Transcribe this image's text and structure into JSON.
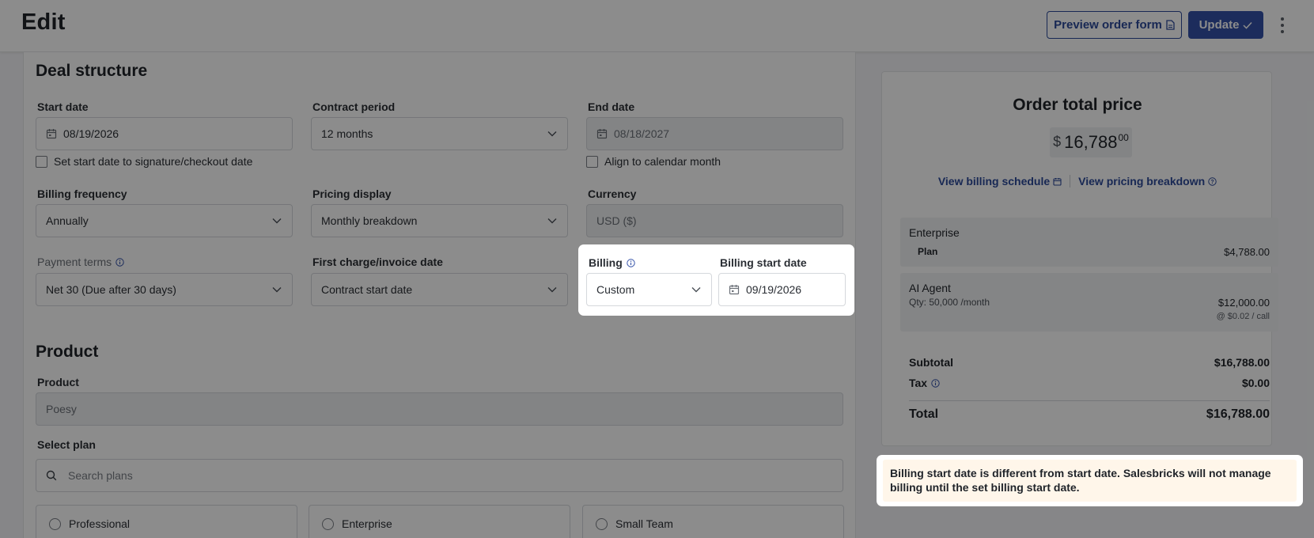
{
  "header": {
    "title": "Edit",
    "preview_label": "Preview order form",
    "update_label": "Update"
  },
  "deal": {
    "title": "Deal structure",
    "start_date": {
      "label": "Start date",
      "value": "08/19/2026"
    },
    "signature_checkbox": "Set start date to signature/checkout date",
    "contract_period": {
      "label": "Contract period",
      "value": "12 months"
    },
    "end_date": {
      "label": "End date",
      "value": "08/18/2027"
    },
    "calendar_checkbox": "Align to calendar month",
    "billing_frequency": {
      "label": "Billing frequency",
      "value": "Annually"
    },
    "pricing_display": {
      "label": "Pricing display",
      "value": "Monthly breakdown"
    },
    "currency": {
      "label": "Currency",
      "value": "USD ($)"
    },
    "payment_terms": {
      "label": "Payment terms",
      "value": "Net 30 (Due after 30 days)"
    },
    "first_charge": {
      "label": "First charge/invoice date",
      "value": "Contract start date"
    },
    "billing": {
      "label": "Billing",
      "value": "Custom"
    },
    "billing_start": {
      "label": "Billing start date",
      "value": "09/19/2026"
    }
  },
  "product": {
    "title": "Product",
    "product_label": "Product",
    "product_value": "Poesy",
    "select_plan_label": "Select plan",
    "search_placeholder": "Search plans",
    "plans": [
      "Professional",
      "Enterprise",
      "Small Team"
    ]
  },
  "summary": {
    "title": "Order total price",
    "currency_symbol": "$",
    "amount": "16,788",
    "cents": "00",
    "billing_schedule_link": "View billing schedule",
    "pricing_breakdown_link": "View pricing breakdown",
    "items": [
      {
        "name": "Enterprise",
        "tag": "Plan",
        "price": "$4,788.00"
      },
      {
        "name": "AI Agent",
        "qty": "Qty: 50,000 /month",
        "price": "$12,000.00",
        "note": "@ $0.02 / call"
      }
    ],
    "subtotal_label": "Subtotal",
    "subtotal": "$16,788.00",
    "tax_label": "Tax",
    "tax": "$0.00",
    "total_label": "Total",
    "total": "$16,788.00"
  },
  "notice": {
    "text": "Billing start date is different from start date. Salesbricks will not manage billing until the set billing start date."
  },
  "colors": {
    "accent": "#3351a8",
    "notice_bg": "#fff6ea",
    "overlay": "rgba(0,0,0,0.45)"
  }
}
